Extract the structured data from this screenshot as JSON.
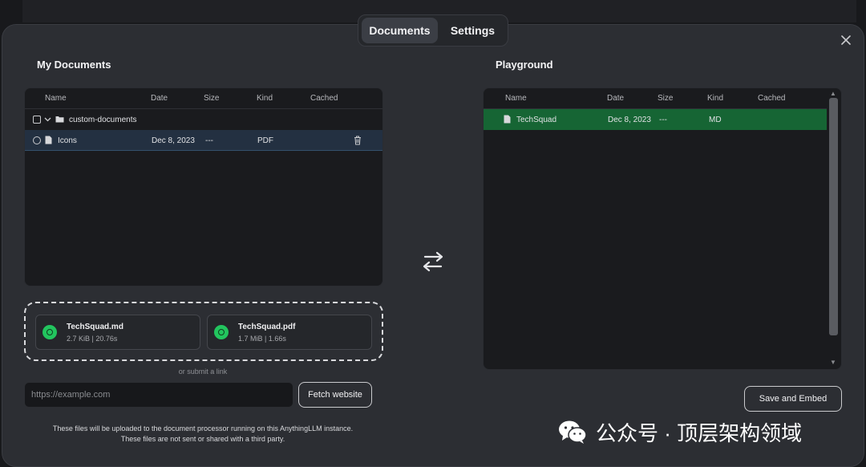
{
  "tabs": [
    {
      "label": "Documents",
      "active": true
    },
    {
      "label": "Settings",
      "active": false
    }
  ],
  "close_icon": "close-icon",
  "my_documents": {
    "title": "My Documents",
    "columns": [
      "Name",
      "Date",
      "Size",
      "Kind",
      "Cached"
    ],
    "folder": {
      "name": "custom-documents"
    },
    "rows": [
      {
        "name": "Icons",
        "date": "Dec 8, 2023",
        "size": "---",
        "kind": "PDF"
      }
    ]
  },
  "playground": {
    "title": "Playground",
    "columns": [
      "Name",
      "Date",
      "Size",
      "Kind",
      "Cached"
    ],
    "rows": [
      {
        "name": "TechSquad",
        "date": "Dec 8, 2023",
        "size": "---",
        "kind": "MD"
      }
    ]
  },
  "uploads": [
    {
      "name": "TechSquad.md",
      "meta": "2.7 KiB | 20.76s",
      "status": "success"
    },
    {
      "name": "TechSquad.pdf",
      "meta": "1.7 MiB | 1.66s",
      "status": "success"
    }
  ],
  "link": {
    "or_text": "or submit a link",
    "placeholder": "https://example.com",
    "fetch_label": "Fetch website"
  },
  "footnote": {
    "line1": "These files will be uploaded to the document processor running on this AnythingLLM instance.",
    "line2": "These files are not sent or shared with a third party."
  },
  "save_embed_label": "Save and Embed",
  "watermark": {
    "text": "公众号 · 顶层架构领域"
  },
  "colors": {
    "modal_bg": "#2c2e33",
    "panel_bg": "#1a1b1e",
    "selected_row": "#233041",
    "playground_row": "#166534",
    "success": "#22c55e"
  }
}
